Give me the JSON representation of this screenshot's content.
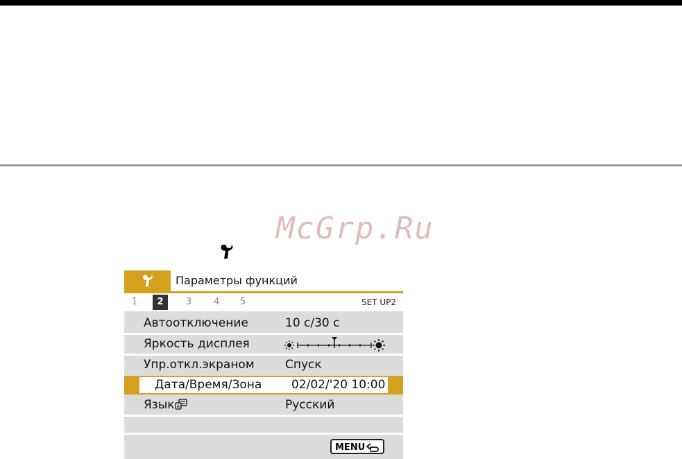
{
  "watermark": "McGrp.Ru",
  "header": {
    "title": "Параметры функций",
    "tab_icon": "wrench-icon"
  },
  "tabs": [
    "1",
    "2",
    "3",
    "4",
    "5"
  ],
  "active_tab": "2",
  "set_label": "SET UP2",
  "rows": [
    {
      "label": "Автоотключение",
      "value": "10 с/30 с"
    },
    {
      "label": "Яркость дисплея",
      "value": "",
      "brightness_level": 0.55
    },
    {
      "label": "Упр.откл.экраном",
      "value": "Спуск"
    },
    {
      "label": "Дата/Время/Зона",
      "value": "02/02/'20 10:00",
      "selected": true
    },
    {
      "label": "Язык",
      "value": "Русский",
      "label_icon": "language-icon"
    }
  ],
  "footer": {
    "button_label": "MENU",
    "button_icon": "back-arrow-icon"
  },
  "colors": {
    "accent": "#d4a020",
    "panel": "#dcdcdc"
  }
}
